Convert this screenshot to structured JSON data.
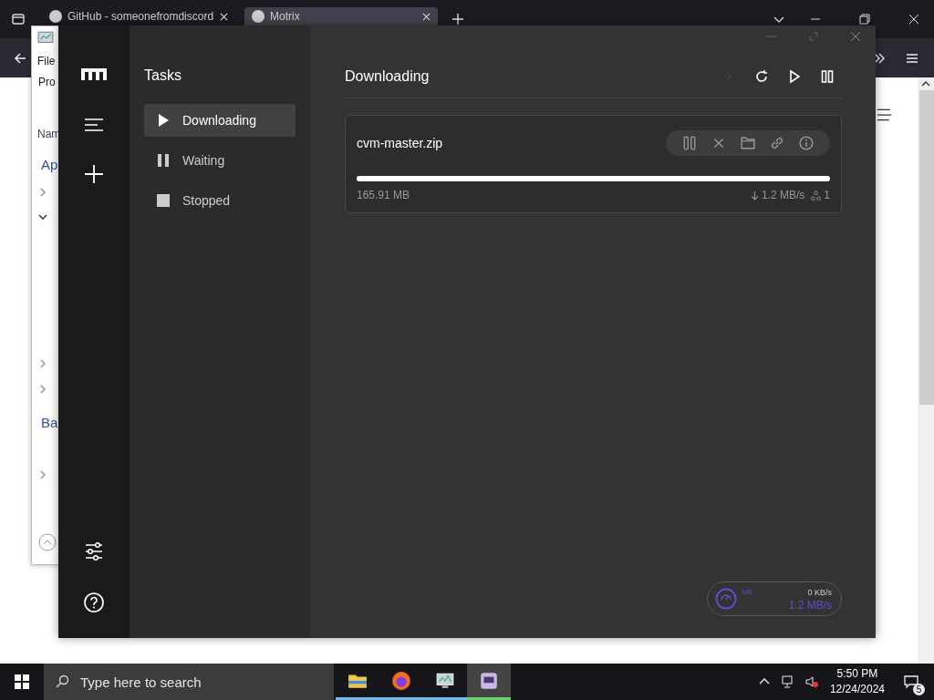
{
  "browser": {
    "tabs": [
      {
        "title": "GitHub - someonefromdiscord",
        "selected": false
      },
      {
        "title": "Motrix",
        "selected": true
      }
    ]
  },
  "task_manager": {
    "menu": "File",
    "tab": "Pro",
    "column": "Nam",
    "groups": [
      "Ap",
      "Ba"
    ]
  },
  "motrix": {
    "section_title": "Tasks",
    "nav": [
      {
        "label": "Downloading",
        "kind": "downloading",
        "selected": true
      },
      {
        "label": "Waiting",
        "kind": "waiting",
        "selected": false
      },
      {
        "label": "Stopped",
        "kind": "stopped",
        "selected": false
      }
    ],
    "header": "Downloading",
    "tasks": [
      {
        "name": "cvm-master.zip",
        "level": 1,
        "size": "165.91 MB",
        "speed": "1.2 MB/s",
        "connections": "1"
      }
    ],
    "speedometer": {
      "unit": "MB",
      "upload": "0 KB/s",
      "download": "1.2 MB/s"
    }
  },
  "taskbar": {
    "search_placeholder": "Type here to search",
    "apps": [
      {
        "kind": "folder",
        "selected": false
      },
      {
        "kind": "browser",
        "selected": false
      },
      {
        "kind": "monitor",
        "selected": false
      },
      {
        "kind": "motrix",
        "selected": true
      }
    ],
    "time": "5:50 PM",
    "date": "12/24/2024",
    "notifications": "5"
  }
}
